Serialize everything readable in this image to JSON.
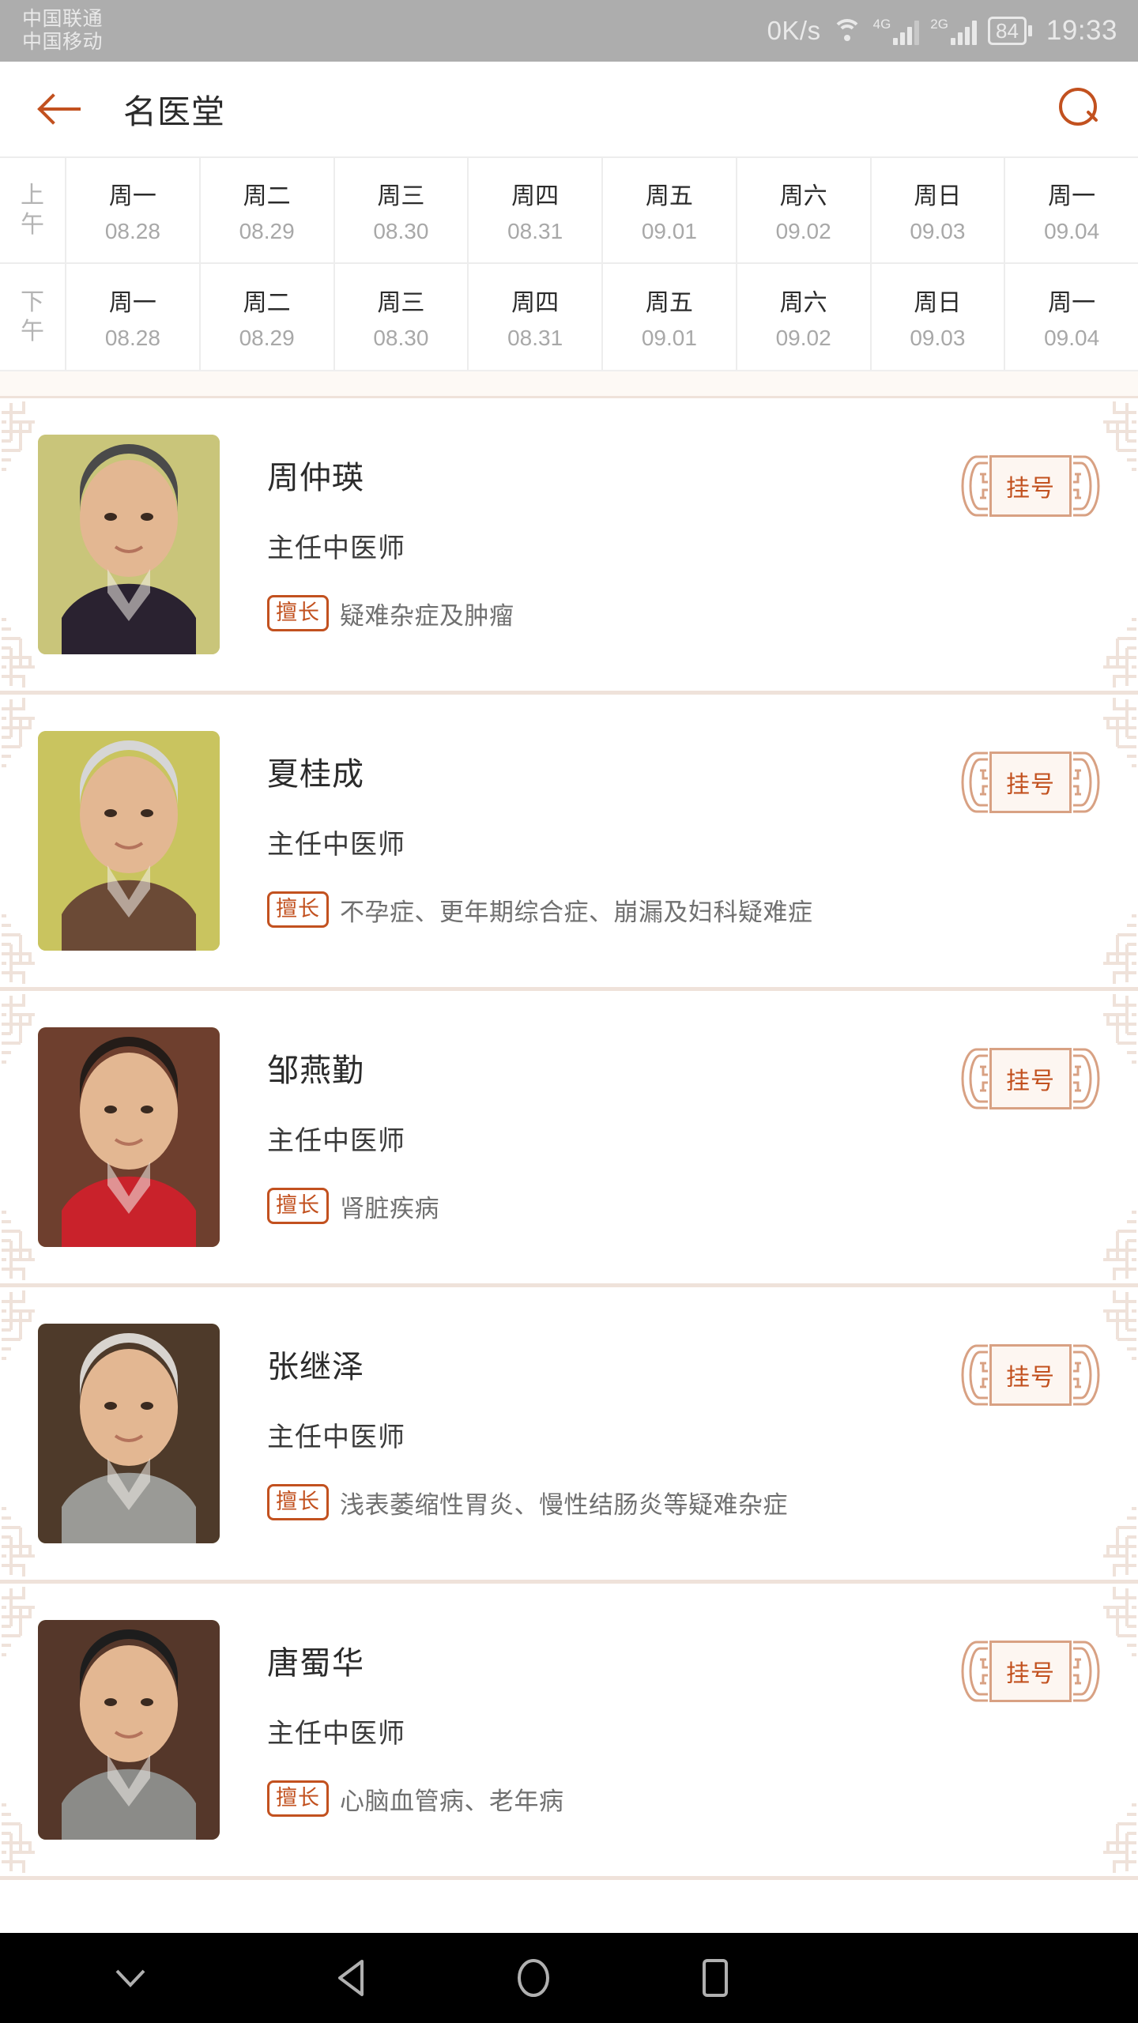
{
  "status_bar": {
    "carriers": [
      "中国联通",
      "中国移动"
    ],
    "net_speed": "0K/s",
    "wifi_icon": "wifi-icon",
    "sim1_network": "4G",
    "sim2_network": "2G",
    "battery_level": "84",
    "clock": "19:33"
  },
  "header": {
    "back_icon": "back-arrow-icon",
    "title": "名医堂",
    "search_icon": "search-icon"
  },
  "schedule": {
    "rows": [
      {
        "period": "上午",
        "period_line1": "上",
        "period_line2": "午",
        "cells": [
          {
            "day": "周一",
            "date": "08.28"
          },
          {
            "day": "周二",
            "date": "08.29"
          },
          {
            "day": "周三",
            "date": "08.30"
          },
          {
            "day": "周四",
            "date": "08.31"
          },
          {
            "day": "周五",
            "date": "09.01"
          },
          {
            "day": "周六",
            "date": "09.02"
          },
          {
            "day": "周日",
            "date": "09.03"
          },
          {
            "day": "周一",
            "date": "09.04"
          }
        ]
      },
      {
        "period": "下午",
        "period_line1": "下",
        "period_line2": "午",
        "cells": [
          {
            "day": "周一",
            "date": "08.28"
          },
          {
            "day": "周二",
            "date": "08.29"
          },
          {
            "day": "周三",
            "date": "08.30"
          },
          {
            "day": "周四",
            "date": "08.31"
          },
          {
            "day": "周五",
            "date": "09.01"
          },
          {
            "day": "周六",
            "date": "09.02"
          },
          {
            "day": "周日",
            "date": "09.03"
          },
          {
            "day": "周一",
            "date": "09.04"
          }
        ]
      }
    ]
  },
  "doctor_list": {
    "skill_badge_label": "擅长",
    "register_button_label": "挂号",
    "doctors": [
      {
        "name": "周仲瑛",
        "title": "主任中医师",
        "skill": "疑难杂症及肿瘤",
        "avatar_bg": "#c9c57a",
        "avatar_hair": "#4a4a4a",
        "avatar_clothes": "#2a2230"
      },
      {
        "name": "夏桂成",
        "title": "主任中医师",
        "skill": "不孕症、更年期综合症、崩漏及妇科疑难症",
        "avatar_bg": "#c9c45f",
        "avatar_hair": "#d6d6d6",
        "avatar_clothes": "#6b4a36"
      },
      {
        "name": "邹燕勤",
        "title": "主任中医师",
        "skill": "肾脏疾病",
        "avatar_bg": "#6e3f2e",
        "avatar_hair": "#241c18",
        "avatar_clothes": "#c9222b"
      },
      {
        "name": "张继泽",
        "title": "主任中医师",
        "skill": "浅表萎缩性胃炎、慢性结肠炎等疑难杂症",
        "avatar_bg": "#4e3a2a",
        "avatar_hair": "#d8d4cf",
        "avatar_clothes": "#9a9a96"
      },
      {
        "name": "唐蜀华",
        "title": "主任中医师",
        "skill": "心脑血管病、老年病",
        "avatar_bg": "#55372a",
        "avatar_hair": "#1d1d1d",
        "avatar_clothes": "#8b8b88"
      }
    ]
  },
  "nav_bar": {
    "hide_keyboard_icon": "chevron-down-icon",
    "back_icon": "triangle-back-icon",
    "home_icon": "circle-home-icon",
    "recents_icon": "square-recents-icon"
  },
  "colors": {
    "accent": "#c2511f",
    "ornament": "#efe2da",
    "status_bar_bg": "#adadad",
    "gap_band_bg": "#fdf9f5",
    "register_border": "#d8a183",
    "register_fill": "#fdf6f1"
  }
}
